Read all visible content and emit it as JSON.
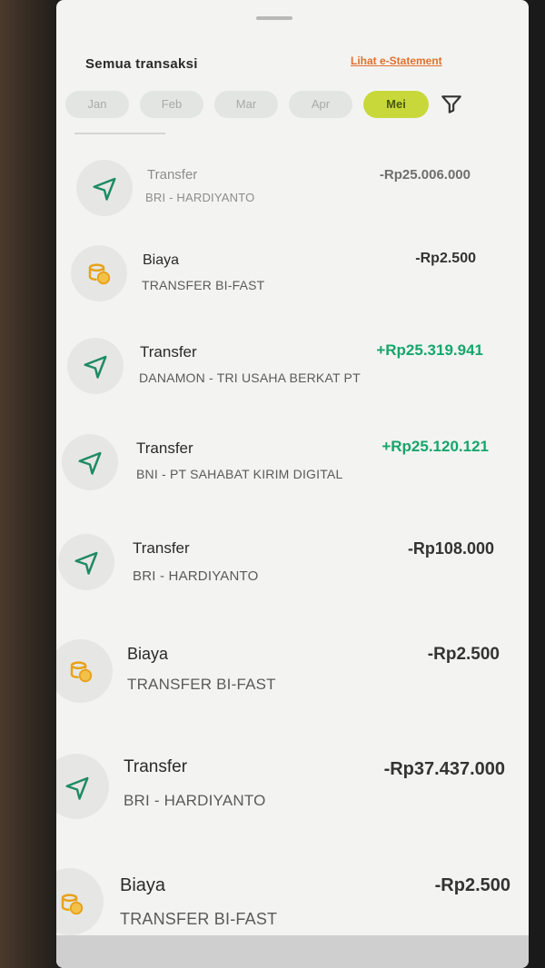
{
  "header": {
    "title": "Semua transaksi",
    "estatement_link": "Lihat e-Statement"
  },
  "months": [
    {
      "label": "Jan",
      "active": false
    },
    {
      "label": "Feb",
      "active": false
    },
    {
      "label": "Mar",
      "active": false
    },
    {
      "label": "Apr",
      "active": false
    },
    {
      "label": "Mei",
      "active": true
    }
  ],
  "transactions": [
    {
      "type": "Transfer",
      "desc": "BRI - HARDIYANTO",
      "amount": "-Rp25.006.000",
      "direction": "out",
      "icon": "send-icon"
    },
    {
      "type": "Biaya",
      "desc": "TRANSFER BI-FAST",
      "amount": "-Rp2.500",
      "direction": "out",
      "icon": "coin-fee-icon"
    },
    {
      "type": "Transfer",
      "desc": "DANAMON - TRI USAHA BERKAT PT",
      "amount": "+Rp25.319.941",
      "direction": "in",
      "icon": "send-icon"
    },
    {
      "type": "Transfer",
      "desc": "BNI - PT SAHABAT KIRIM DIGITAL",
      "amount": "+Rp25.120.121",
      "direction": "in",
      "icon": "send-icon"
    },
    {
      "type": "Transfer",
      "desc": "BRI - HARDIYANTO",
      "amount": "-Rp108.000",
      "direction": "out",
      "icon": "send-icon"
    },
    {
      "type": "Biaya",
      "desc": "TRANSFER BI-FAST",
      "amount": "-Rp2.500",
      "direction": "out",
      "icon": "coin-fee-icon"
    },
    {
      "type": "Transfer",
      "desc": "BRI - HARDIYANTO",
      "amount": "-Rp37.437.000",
      "direction": "out",
      "icon": "send-icon"
    },
    {
      "type": "Biaya",
      "desc": "TRANSFER BI-FAST",
      "amount": "-Rp2.500",
      "direction": "out",
      "icon": "coin-fee-icon"
    }
  ],
  "colors": {
    "accent": "#c8d83a",
    "incoming": "#17a56b",
    "link": "#e2702e",
    "send_icon": "#1f8a66",
    "fee_icon": "#e8a21a"
  }
}
